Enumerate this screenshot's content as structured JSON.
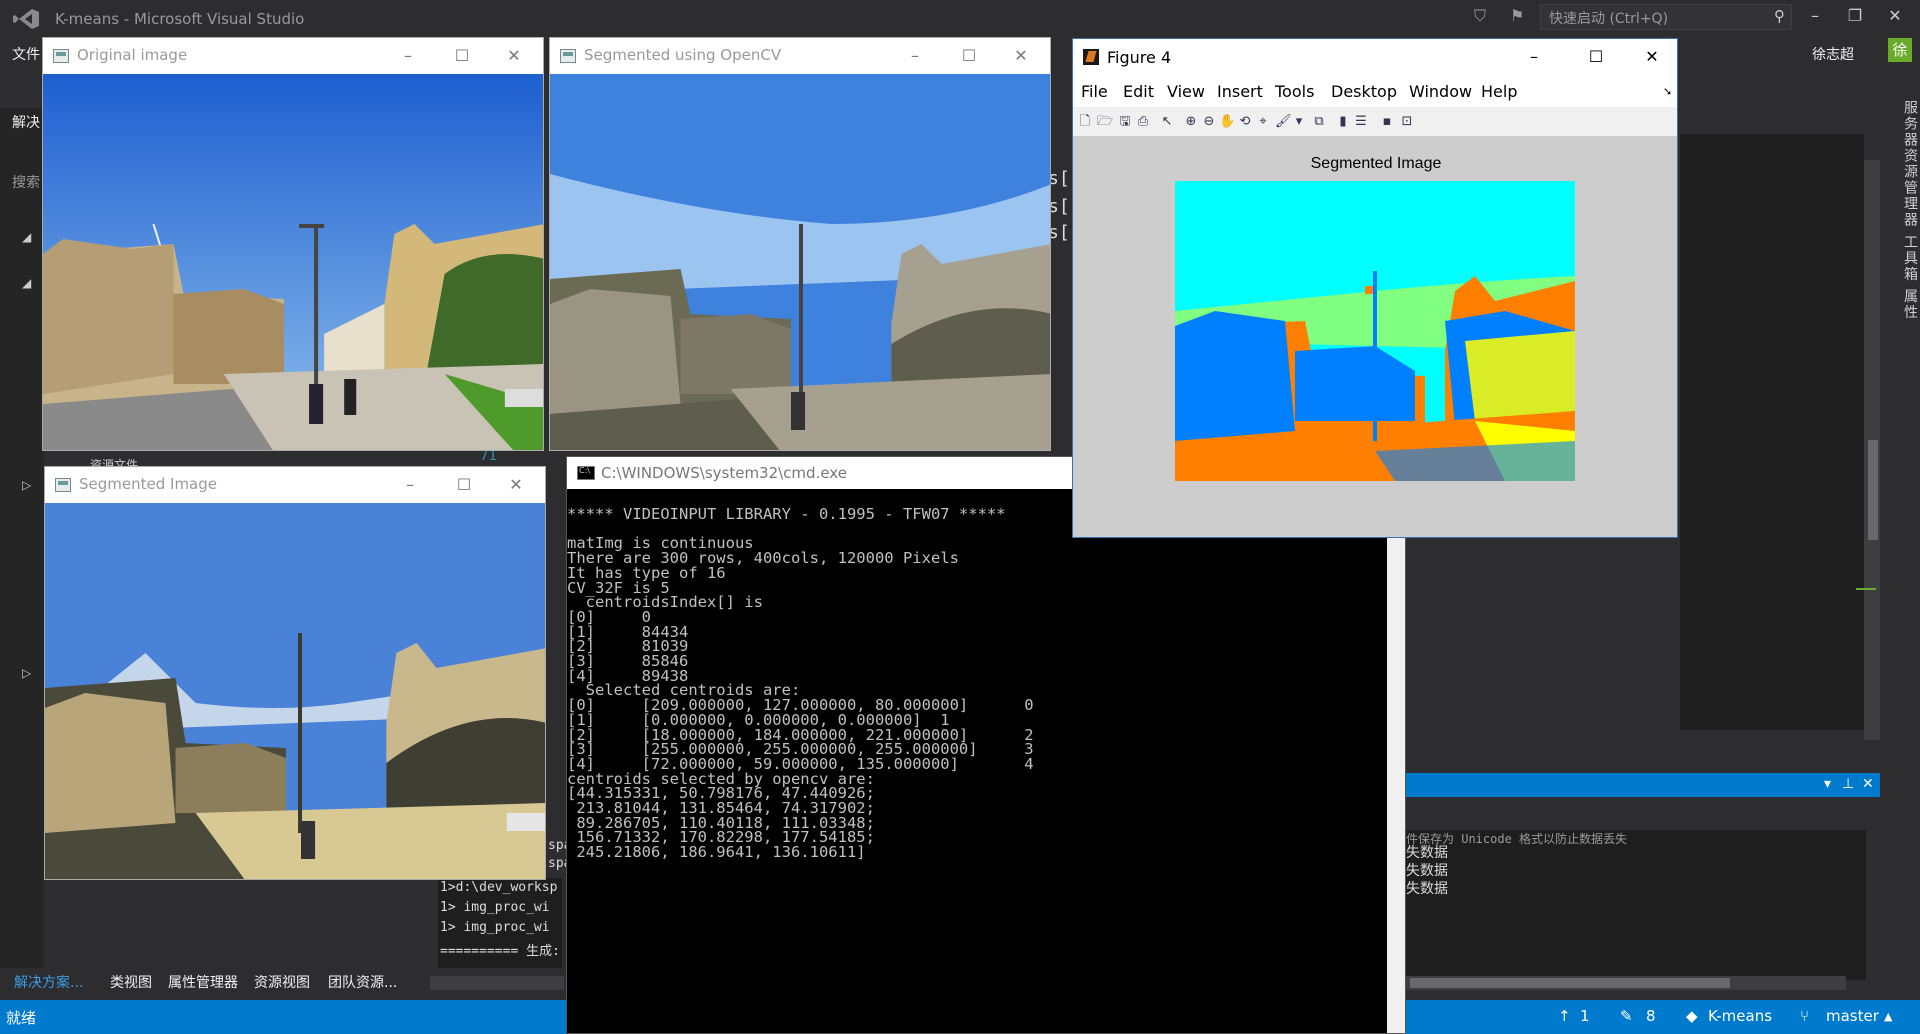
{
  "vs": {
    "title": "K-means - Microsoft Visual Studio",
    "quick_launch_placeholder": "快速启动 (Ctrl+Q)",
    "menu_file": "文件",
    "user": "徐志超",
    "avatar_letter": "徐",
    "left_panel_label": "解决",
    "left_search_label": "搜索",
    "right_vertical_tabs": "服务器资源管理器 工具箱 属性",
    "bottom_tabs": [
      "解决方案...",
      "类视图",
      "属性管理器",
      "资源视图",
      "团队资源..."
    ],
    "output_lines": [
      "失数据",
      "失数据",
      "失数据"
    ],
    "output_partial": "件保存为 Unicode 格式以防止数据丢失",
    "build_lines": [
      "1>d:\\dev_worksp",
      "1>  img_proc_wi",
      "1>  img_proc_wi",
      "========== 生成:"
    ],
    "behind_fragments": [
      "s[",
      "s[",
      "s[",
      "spa",
      "spa",
      "71",
      "资源文件"
    ],
    "status": {
      "ready": "就绪",
      "up_count": "1",
      "pending_count": "8",
      "repo": "K-means",
      "branch": "master"
    }
  },
  "windows": {
    "original": {
      "title": "Original image"
    },
    "opencv": {
      "title": "Segmented using OpenCV"
    },
    "segmented": {
      "title": "Segmented Image"
    },
    "cmd": {
      "title": "C:\\WINDOWS\\system32\\cmd.exe"
    },
    "figure": {
      "title": "Figure 4",
      "menu": [
        "File",
        "Edit",
        "View",
        "Insert",
        "Tools",
        "Desktop",
        "Window",
        "Help"
      ],
      "plot_title": "Segmented Image"
    }
  },
  "cmd_output": [
    "***** VIDEOINPUT LIBRARY - 0.1995 - TFW07 *****",
    "",
    "matImg is continuous",
    "There are 300 rows, 400cols, 120000 Pixels",
    "It has type of 16",
    "CV_32F is 5",
    "  centroidsIndex[] is",
    "[0]     0",
    "[1]     84434",
    "[2]     81039",
    "[3]     85846",
    "[4]     89438",
    "  Selected centroids are:",
    "[0]     [209.000000, 127.000000, 80.000000]      0",
    "[1]     [0.000000, 0.000000, 0.000000]  1",
    "[2]     [18.000000, 184.000000, 221.000000]      2",
    "[3]     [255.000000, 255.000000, 255.000000]     3",
    "[4]     [72.000000, 59.000000, 135.000000]       4",
    "centroids selected by opencv are:",
    "[44.315331, 50.798176, 47.440926;",
    " 213.81044, 131.85464, 74.317902;",
    " 89.286705, 110.40118, 111.03348;",
    " 156.71332, 170.82298, 177.54185;",
    " 245.21806, 186.9641, 136.10611]"
  ],
  "colors": {
    "vs_bg": "#2d2d30",
    "vs_blue": "#007acc",
    "fig_cyan": "#00ffff",
    "fig_orange": "#ff8000",
    "fig_blue": "#0080ff",
    "fig_green": "#80ff80",
    "fig_yellow": "#ffff00"
  }
}
